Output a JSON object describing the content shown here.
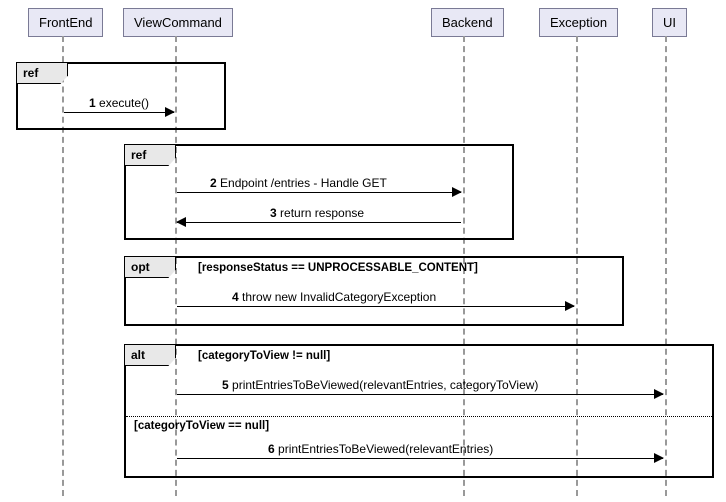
{
  "participants": {
    "frontend": "FrontEnd",
    "viewcommand": "ViewCommand",
    "backend": "Backend",
    "exception": "Exception",
    "ui": "UI"
  },
  "frames": {
    "ref1": {
      "label": "ref"
    },
    "ref2": {
      "label": "ref"
    },
    "opt": {
      "label": "opt",
      "guard": "[responseStatus == UNPROCESSABLE_CONTENT]"
    },
    "alt": {
      "label": "alt",
      "guard1": "[categoryToView != null]",
      "guard2": "[categoryToView == null]"
    }
  },
  "messages": {
    "m1": {
      "num": "1",
      "text": "execute()"
    },
    "m2": {
      "num": "2",
      "text": "Endpoint /entries - Handle GET"
    },
    "m3": {
      "num": "3",
      "text": "return response"
    },
    "m4": {
      "num": "4",
      "text": "throw new InvalidCategoryException"
    },
    "m5": {
      "num": "5",
      "text": "printEntriesToBeViewed(relevantEntries, categoryToView)"
    },
    "m6": {
      "num": "6",
      "text": "printEntriesToBeViewed(relevantEntries)"
    }
  },
  "chart_data": {
    "type": "sequence-diagram",
    "participants": [
      "FrontEnd",
      "ViewCommand",
      "Backend",
      "Exception",
      "UI"
    ],
    "fragments": [
      {
        "type": "ref",
        "covers": [
          "FrontEnd",
          "ViewCommand"
        ],
        "messages": [
          {
            "seq": 1,
            "from": "FrontEnd",
            "to": "ViewCommand",
            "label": "execute()",
            "kind": "call"
          }
        ]
      },
      {
        "type": "ref",
        "covers": [
          "ViewCommand",
          "Backend"
        ],
        "messages": [
          {
            "seq": 2,
            "from": "ViewCommand",
            "to": "Backend",
            "label": "Endpoint /entries - Handle GET",
            "kind": "call"
          },
          {
            "seq": 3,
            "from": "Backend",
            "to": "ViewCommand",
            "label": "return response",
            "kind": "return"
          }
        ]
      },
      {
        "type": "opt",
        "guard": "responseStatus == UNPROCESSABLE_CONTENT",
        "covers": [
          "ViewCommand",
          "Backend",
          "Exception"
        ],
        "messages": [
          {
            "seq": 4,
            "from": "ViewCommand",
            "to": "Exception",
            "label": "throw new InvalidCategoryException",
            "kind": "call"
          }
        ]
      },
      {
        "type": "alt",
        "covers": [
          "ViewCommand",
          "Backend",
          "Exception",
          "UI"
        ],
        "operands": [
          {
            "guard": "categoryToView != null",
            "messages": [
              {
                "seq": 5,
                "from": "ViewCommand",
                "to": "UI",
                "label": "printEntriesToBeViewed(relevantEntries, categoryToView)",
                "kind": "call"
              }
            ]
          },
          {
            "guard": "categoryToView == null",
            "messages": [
              {
                "seq": 6,
                "from": "ViewCommand",
                "to": "UI",
                "label": "printEntriesToBeViewed(relevantEntries)",
                "kind": "call"
              }
            ]
          }
        ]
      }
    ]
  }
}
